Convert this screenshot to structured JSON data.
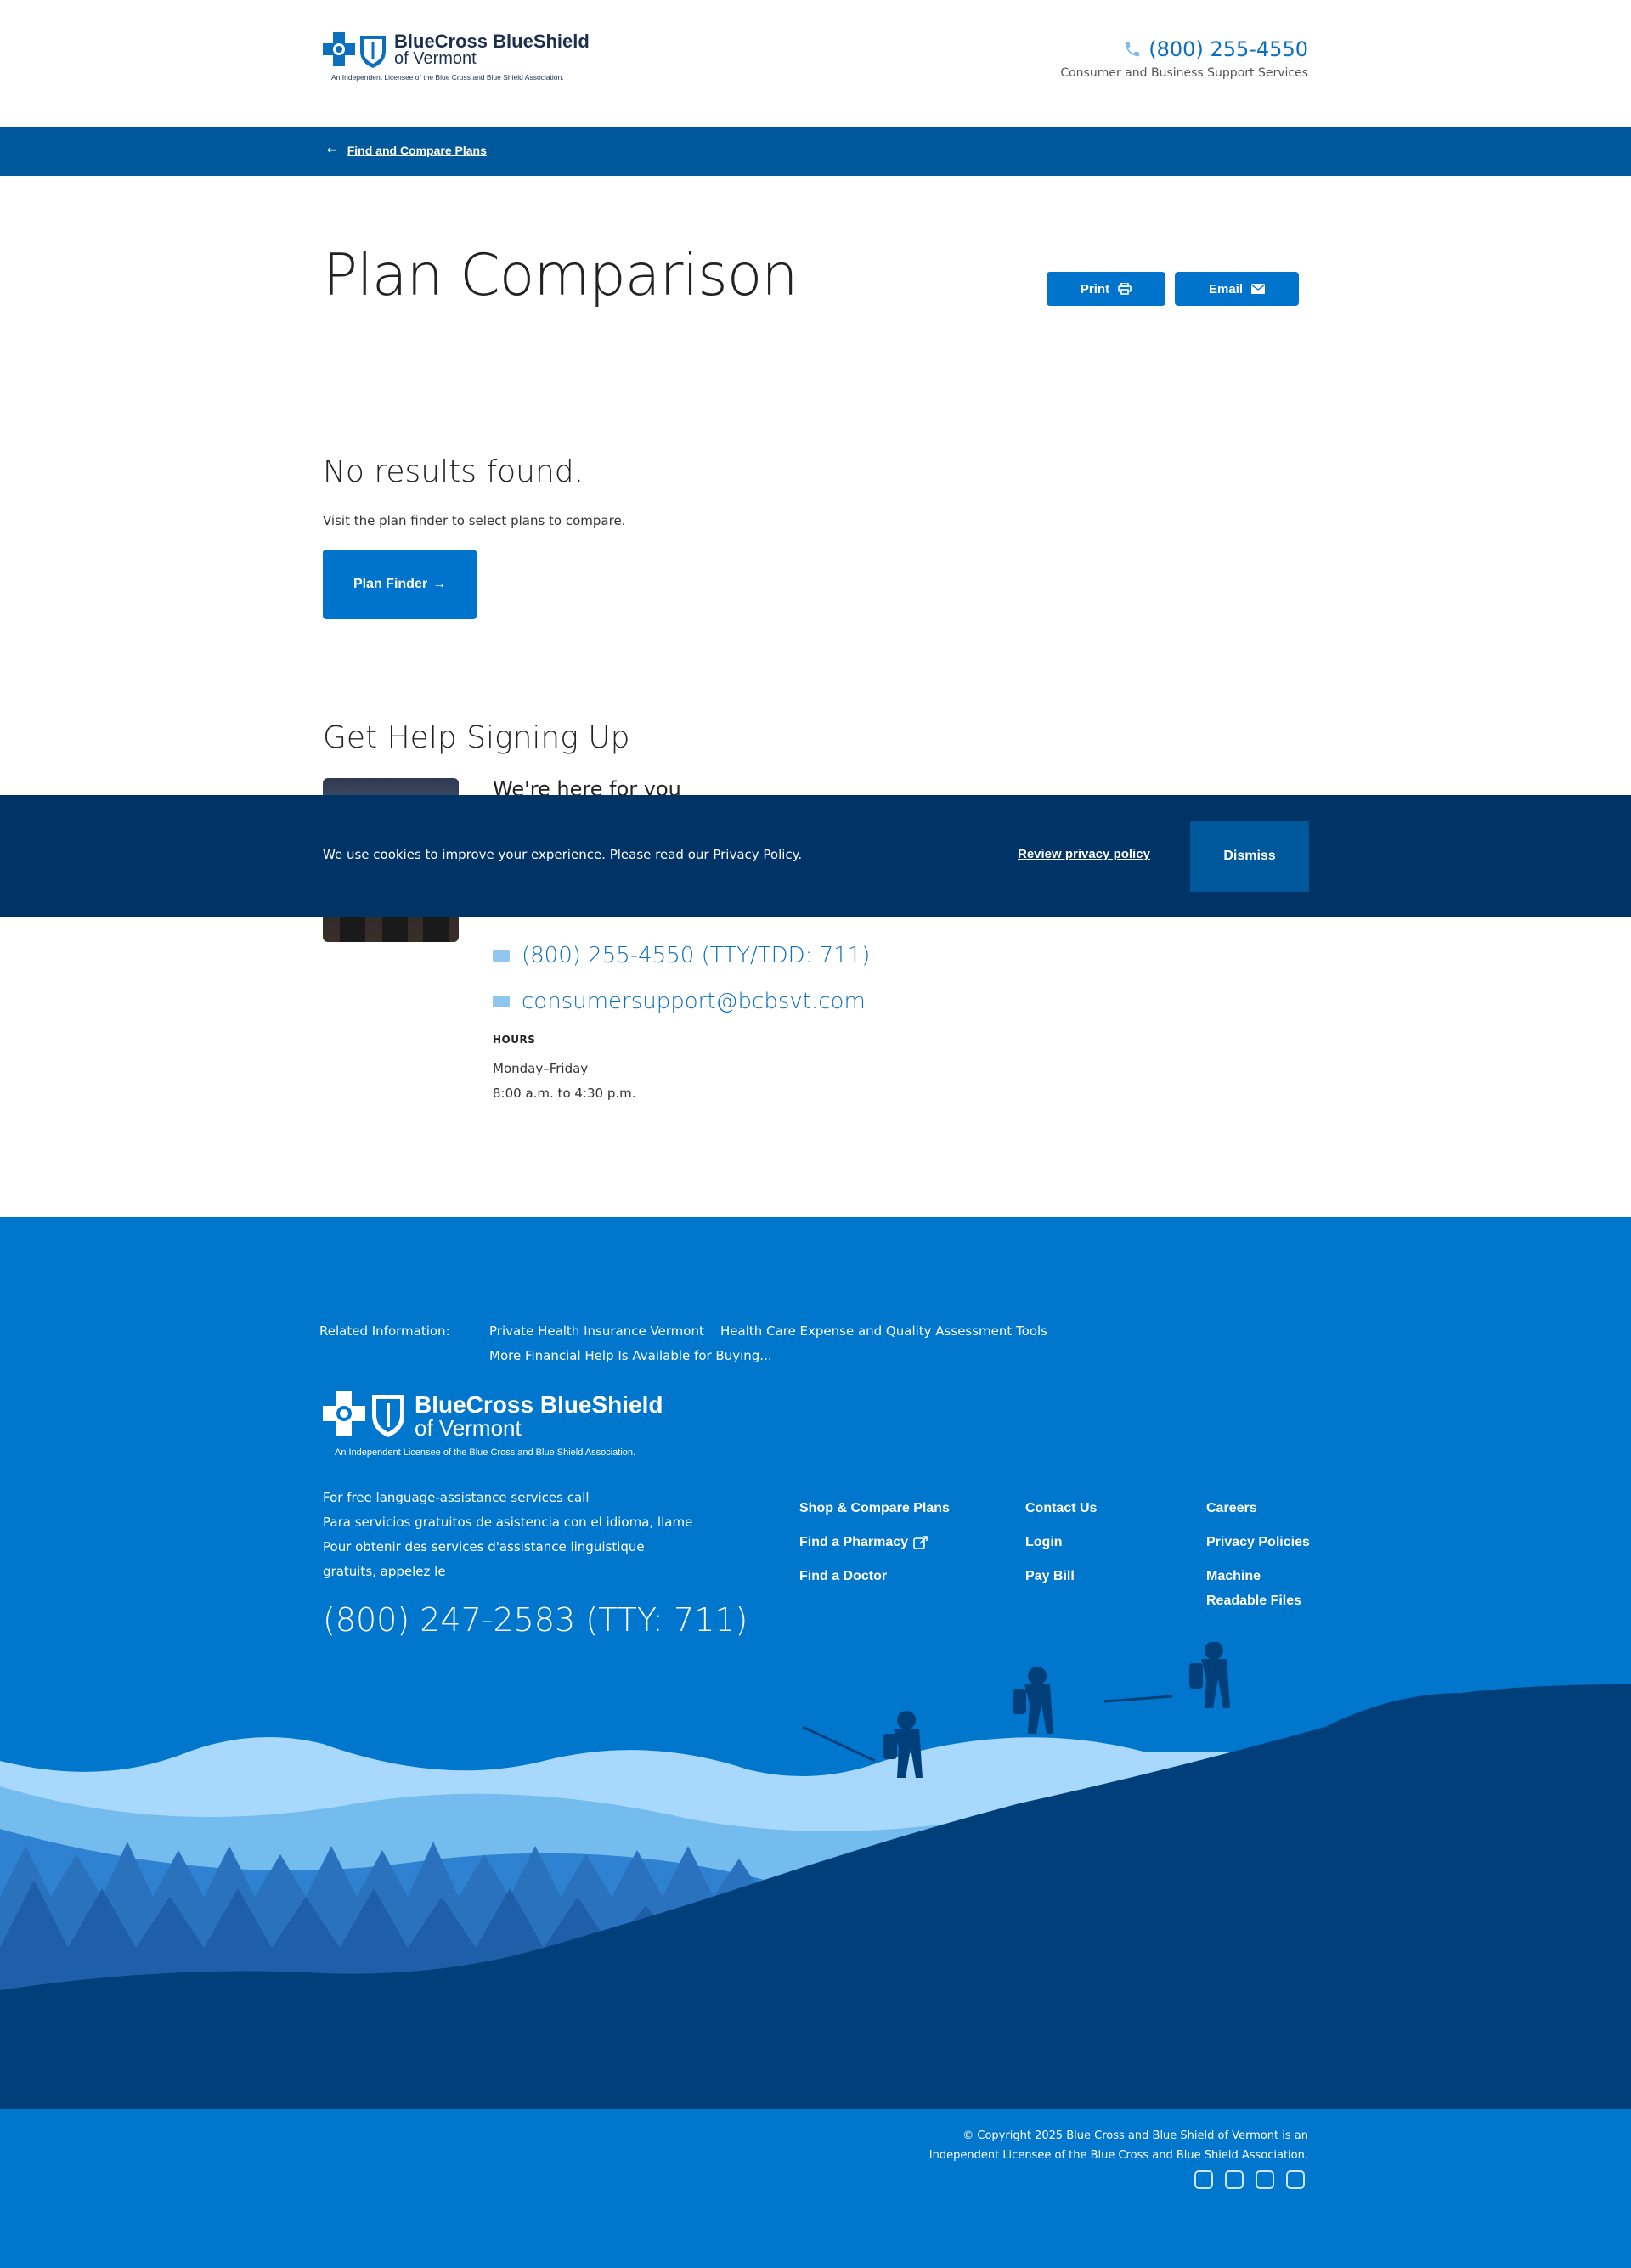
{
  "header": {
    "logo": {
      "brand_line1": "BlueCross BlueShield",
      "brand_line2": "of Vermont",
      "licensee": "An Independent Licensee of the Blue Cross and Blue Shield Association."
    },
    "phone": "(800) 255-4550",
    "phone_sub": "Consumer and Business Support Services"
  },
  "nav": {
    "back_arrow": "←",
    "back_link": "Find and Compare Plans"
  },
  "main": {
    "title": "Plan Comparison",
    "print_label": "Print",
    "email_label": "Email",
    "no_results_title": "No results found.",
    "no_results_sub": "Visit the plan finder to select plans to compare.",
    "finder_label": "Plan Finder",
    "finder_arrow": "→"
  },
  "help": {
    "title": "Get Help Signing Up",
    "here": "We're here for you",
    "phone": "(800) 255-4550 (TTY/TDD: 711)",
    "email": "consumersupport@bcbsvt.com",
    "hours_label": "HOURS",
    "hours_days": "Monday–Friday",
    "hours_time": "8:00 a.m. to 4:30 p.m."
  },
  "cookie": {
    "message": "We use cookies to improve your experience. Please read our Privacy Policy.",
    "review": "Review privacy policy",
    "dismiss": "Dismiss"
  },
  "footer": {
    "related_label": "Related Information:",
    "related_links": [
      "Private Health Insurance Vermont",
      "Health Care Expense and Quality Assessment Tools",
      "More Financial Help Is Available for Buying..."
    ],
    "logo": {
      "brand_line1": "BlueCross BlueShield",
      "brand_line2": "of Vermont",
      "licensee": "An Independent Licensee of the Blue Cross and Blue Shield Association."
    },
    "language_lines": [
      "For free language-assistance services call",
      "Para servicios gratuitos de asistencia con el idioma, llame",
      "Pour obtenir des services d'assistance linguistique",
      "gratuits, appelez le"
    ],
    "language_phone": "(800) 247-2583 (TTY: 711)",
    "links_col1": [
      "Shop & Compare Plans",
      "Find a Pharmacy",
      "Find a Doctor"
    ],
    "links_col2": [
      "Contact Us",
      "Login",
      "Pay Bill"
    ],
    "links_col3": [
      "Careers",
      "Privacy Policies",
      "Machine",
      "Readable Files"
    ],
    "copyright_line1": "© Copyright 2025 Blue Cross and Blue Shield of Vermont is an",
    "copyright_line2": "Independent Licensee of the Blue Cross and Blue Shield Association.",
    "social_icons": [
      "instagram-icon",
      "facebook-icon",
      "linkedin-icon",
      "youtube-icon"
    ]
  },
  "colors": {
    "primary": "#0074cc",
    "header_bar": "#00589c",
    "cookie_bg": "#003366",
    "footer_bg": "#0077cc"
  }
}
